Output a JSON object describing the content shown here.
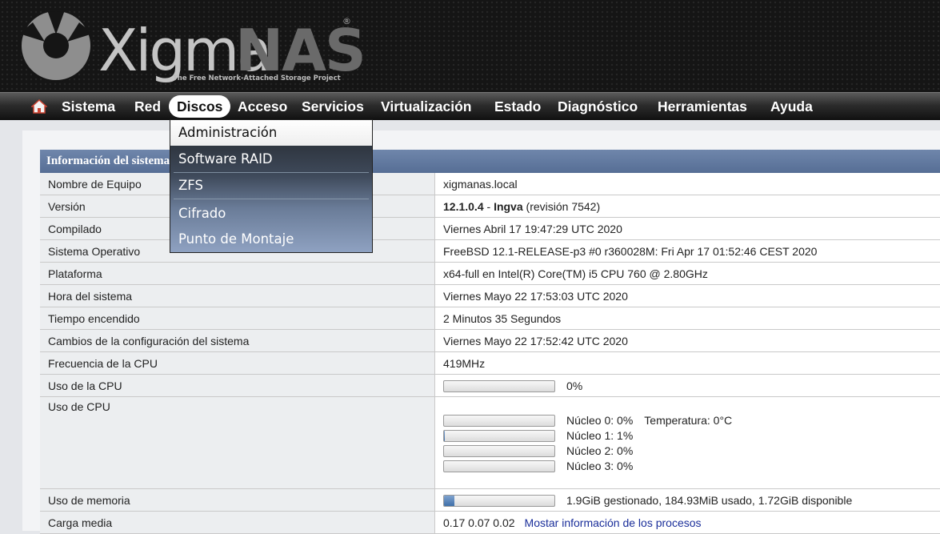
{
  "brand": {
    "name_part1": "Xigma",
    "name_part2": "NAS",
    "registered": "®",
    "tagline": "The Free Network-Attached Storage Project"
  },
  "nav": {
    "home_icon": "home-icon",
    "items": [
      "Sistema",
      "Red",
      "Discos",
      "Acceso",
      "Servicios",
      "Virtualización",
      "Estado",
      "Diagnóstico",
      "Herramientas",
      "Ayuda"
    ],
    "active": "Discos"
  },
  "dropdown": {
    "items": [
      "Administración",
      "Software RAID",
      "ZFS",
      "Cifrado",
      "Punto de Montaje"
    ]
  },
  "sysinfo": {
    "title": "Información del sistema",
    "hostname": {
      "label": "Nombre de Equipo",
      "value": "xigmanas.local"
    },
    "version": {
      "label": "Versión",
      "number": "12.1.0.4",
      "sep": " - ",
      "codename": "Ingva",
      "revision": " (revisión 7542)"
    },
    "built": {
      "label": "Compilado",
      "value": "Viernes Abril 17 19:47:29 UTC 2020"
    },
    "os": {
      "label": "Sistema Operativo",
      "value": "FreeBSD 12.1-RELEASE-p3 #0 r360028M: Fri Apr 17 01:52:46 CEST 2020"
    },
    "platform": {
      "label": "Plataforma",
      "value": "x64-full en Intel(R) Core(TM) i5 CPU 760 @ 2.80GHz"
    },
    "time": {
      "label": "Hora del sistema",
      "value": "Viernes Mayo 22 17:53:03 UTC 2020"
    },
    "uptime": {
      "label": "Tiempo encendido",
      "value": "2 Minutos 35 Segundos"
    },
    "config_changes": {
      "label": "Cambios de la configuración del sistema",
      "value": "Viernes Mayo 22 17:52:42 UTC 2020"
    },
    "cpu_freq": {
      "label": "Frecuencia de la CPU",
      "value": "419MHz"
    },
    "cpu_usage": {
      "label": "Uso de la CPU",
      "percent": 0,
      "text": "0%"
    },
    "cpu_cores": {
      "label": "Uso de CPU",
      "temperature": "Temperatura: 0°C",
      "cores": [
        {
          "text": "Núcleo 0: 0%",
          "percent": 0
        },
        {
          "text": "Núcleo 1: 1%",
          "percent": 1
        },
        {
          "text": "Núcleo 2: 0%",
          "percent": 0
        },
        {
          "text": "Núcleo 3: 0%",
          "percent": 0
        }
      ]
    },
    "memory": {
      "label": "Uso de memoria",
      "percent": 9.5,
      "text": "1.9GiB gestionado, 184.93MiB usado, 1.72GiB disponible"
    },
    "load": {
      "label": "Carga media",
      "value": "0.17 0.07 0.02",
      "link": "Mostar información de los procesos"
    }
  },
  "colors": {
    "accent": "#566e95",
    "link": "#1a2e9a",
    "bar_fill": "#3f6fa8"
  }
}
